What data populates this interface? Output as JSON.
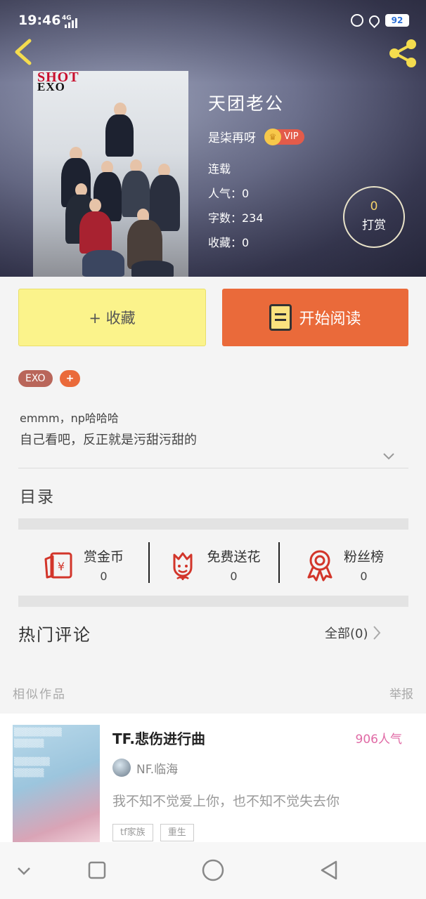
{
  "status_bar": {
    "time": "19:46",
    "network": "4G",
    "battery": "92"
  },
  "book": {
    "title": "天团老公",
    "author": "是柒再呀",
    "vip_label": "VIP",
    "status": "连载",
    "popularity": "人气：0",
    "word_count": "字数：234",
    "favorites": "收藏：0",
    "tip_count": "0",
    "tip_label": "打赏",
    "cover_logo_top": "SHOT",
    "cover_logo_bottom": "EXO"
  },
  "actions": {
    "collect_label": "+ 收藏",
    "read_label": "开始阅读"
  },
  "tags": {
    "tag1": "EXO",
    "add": "+"
  },
  "description": {
    "line1": "emmm，np哈哈哈",
    "line2": "自己看吧，反正就是污甜污甜的"
  },
  "toc_label": "目录",
  "stats": [
    {
      "label": "赏金币",
      "value": "0",
      "icon": "red-envelope-icon"
    },
    {
      "label": "免费送花",
      "value": "0",
      "icon": "flower-icon"
    },
    {
      "label": "粉丝榜",
      "value": "0",
      "icon": "medal-icon"
    }
  ],
  "comments": {
    "title": "热门评论",
    "all_label": "全部(0)"
  },
  "similar": {
    "heading": "相似作品",
    "report": "举报",
    "items": [
      {
        "title": "TF.悲伤进行曲",
        "popularity": "906人气",
        "author": "NF.临海",
        "desc": "我不知不觉爱上你，也不知不觉失去你",
        "tags": [
          "tf家族",
          "重生"
        ]
      }
    ]
  },
  "colors": {
    "accent_orange": "#ea6a3a",
    "collect_yellow": "#fbf38b",
    "pink": "#e06aa5",
    "stat_icon_red": "#d2352a"
  }
}
